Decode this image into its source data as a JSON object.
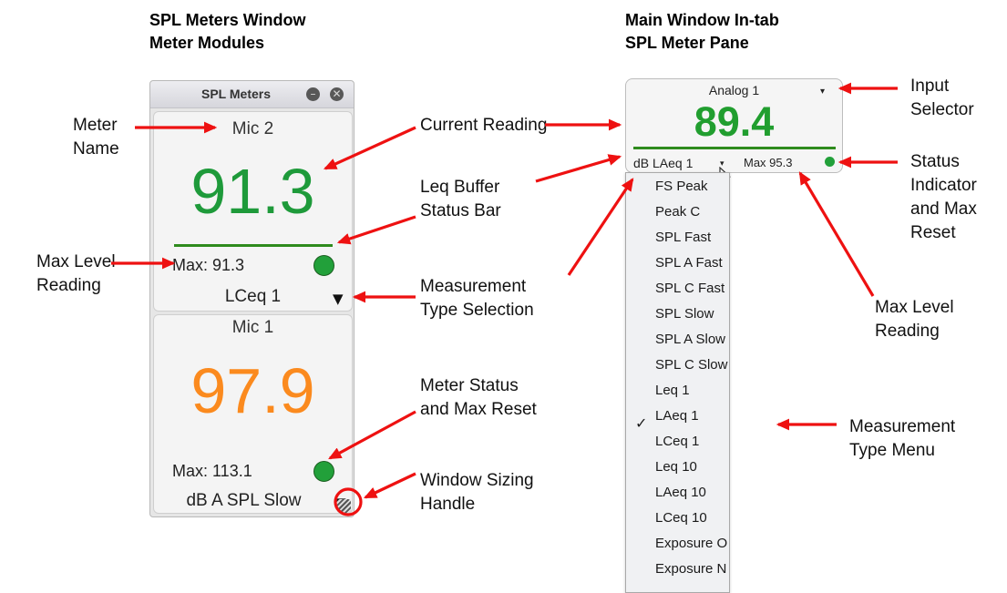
{
  "headings": {
    "left_line1": "SPL Meters Window",
    "left_line2": "Meter Modules",
    "right_line1": "Main Window In-tab",
    "right_line2": "SPL Meter Pane"
  },
  "spl_window": {
    "title": "SPL Meters",
    "minimize_glyph": "–",
    "close_glyph": "✕",
    "modules": [
      {
        "name": "Mic 2",
        "reading": "91.3",
        "reading_color": "#1e9a3a",
        "max": "Max: 91.3",
        "type": "LCeq 1",
        "status_color": "#22a03a"
      },
      {
        "name": "Mic 1",
        "reading": "97.9",
        "reading_color": "#fb8a1e",
        "max": "Max: 113.1",
        "type": "dB A SPL Slow",
        "status_color": "#22a03a"
      }
    ],
    "dropdown_glyph": "▼"
  },
  "pane": {
    "input": "Analog 1",
    "input_arrow": "▾",
    "reading": "89.4",
    "reading_color": "#219e2f",
    "type": "dB LAeq 1",
    "type_arrow": "▾",
    "max": "Max 95.3"
  },
  "menu": {
    "items": [
      "FS Peak",
      "Peak C",
      "SPL Fast",
      "SPL A Fast",
      "SPL C Fast",
      "SPL Slow",
      "SPL A Slow",
      "SPL C Slow",
      "Leq 1",
      "LAeq 1",
      "LCeq 1",
      "Leq 10",
      "LAeq 10",
      "LCeq 10",
      "Exposure O",
      "Exposure N"
    ],
    "checked_item": "LAeq 1",
    "check_glyph": "✓"
  },
  "callouts": {
    "meter_name": [
      "Meter",
      "Name"
    ],
    "current_reading": [
      "Current Reading"
    ],
    "leq_buffer": [
      "Leq Buffer",
      "Status Bar"
    ],
    "max_level_left": [
      "Max Level",
      "Reading"
    ],
    "measurement_type_selection": [
      "Measurement",
      "Type Selection"
    ],
    "meter_status": [
      "Meter Status",
      "and Max Reset"
    ],
    "window_sizing": [
      "Window Sizing",
      "Handle"
    ],
    "input_selector": [
      "Input",
      "Selector"
    ],
    "status_indicator": [
      "Status",
      "Indicator",
      "and Max",
      "Reset"
    ],
    "max_level_right": [
      "Max Level",
      "Reading"
    ],
    "measurement_type_menu": [
      "Measurement",
      "Type Menu"
    ]
  },
  "colors": {
    "arrow": "#ee1111",
    "status_bar": "#2e8b1d"
  }
}
